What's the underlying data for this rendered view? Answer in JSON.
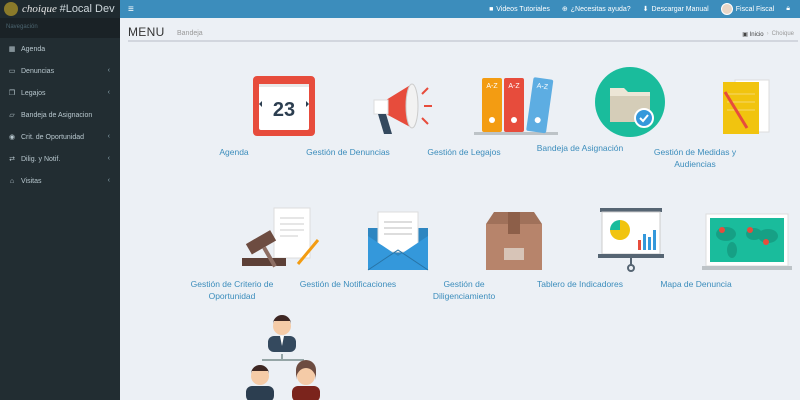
{
  "brand": {
    "name": "choique",
    "env": "#Local Dev"
  },
  "topbar": {
    "links": [
      {
        "icon": "video-icon",
        "label": "Videos Tutoriales"
      },
      {
        "icon": "help-icon",
        "label": "¿Necesitas ayuda?"
      },
      {
        "icon": "download-icon",
        "label": "Descargar Manual"
      },
      {
        "icon": "avatar",
        "label": "Fiscal Fiscal"
      }
    ]
  },
  "sidebar": {
    "header": "Navegación",
    "items": [
      {
        "label": "Agenda",
        "icon": "calendar-icon",
        "submenu": false
      },
      {
        "label": "Denuncias",
        "icon": "inbox-icon",
        "submenu": true
      },
      {
        "label": "Legajos",
        "icon": "copy-icon",
        "submenu": true
      },
      {
        "label": "Bandeja de Asignacion",
        "icon": "folder-icon",
        "submenu": false
      },
      {
        "label": "Crit. de Oportunidad",
        "icon": "eye-icon",
        "submenu": true
      },
      {
        "label": "Dilig. y Notif.",
        "icon": "exchange-icon",
        "submenu": true
      },
      {
        "label": "Visitas",
        "icon": "bank-icon",
        "submenu": true
      }
    ]
  },
  "header": {
    "title": "MENU",
    "subtitle": "Bandeja"
  },
  "breadcrumb": {
    "home": "Inicio",
    "current": "Choique"
  },
  "tiles": [
    {
      "label": "Agenda",
      "icon": "calendar-icon",
      "day": "23"
    },
    {
      "label": "Gestión de Denuncias",
      "icon": "megaphone-icon"
    },
    {
      "label": "Gestión de Legajos",
      "icon": "binders-icon",
      "binder_text": "A-Z"
    },
    {
      "label": "Bandeja de Asignación",
      "icon": "folder-check-icon"
    },
    {
      "label": "Gestión de Medidas y Audiencias",
      "icon": "notes-icon"
    },
    {
      "label": "Gestión de Criterio de Oportunidad",
      "icon": "gavel-icon"
    },
    {
      "label": "Gestión de Notificaciones",
      "icon": "envelope-icon"
    },
    {
      "label": "Gestión de Diligenciamiento",
      "icon": "box-icon"
    },
    {
      "label": "Tablero de Indicadores",
      "icon": "dashboard-board-icon"
    },
    {
      "label": "Mapa de Denuncia",
      "icon": "world-map-icon"
    },
    {
      "label": "",
      "icon": "org-users-icon"
    }
  ]
}
